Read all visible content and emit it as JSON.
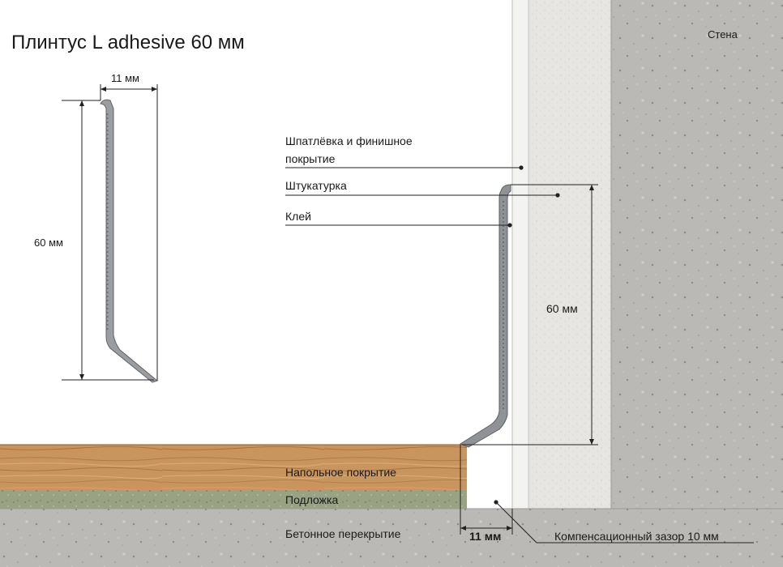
{
  "title": "Плинтус L adhesive 60 мм",
  "profile": {
    "width_label": "11 мм",
    "height_label": "60 мм"
  },
  "section": {
    "wall_label": "Стена",
    "finish_label_line1": "Шпатлёвка и финишное",
    "finish_label_line2": "покрытие",
    "plaster_label": "Штукатурка",
    "glue_label": "Клей",
    "height_label": "60 мм",
    "flooring_label": "Напольное покрытие",
    "underlay_label": "Подложка",
    "slab_label": "Бетонное перекрытие",
    "gap_width_label": "11 мм",
    "comp_gap_label": "Компенсационный зазор 10 мм"
  },
  "colors": {
    "concrete": "#b9b8b4",
    "plaster": "#e3e2de",
    "finish": "#f4f4f2",
    "wood": "#c8955f",
    "underlay": "#9aa483",
    "profile": "#8f9397"
  }
}
